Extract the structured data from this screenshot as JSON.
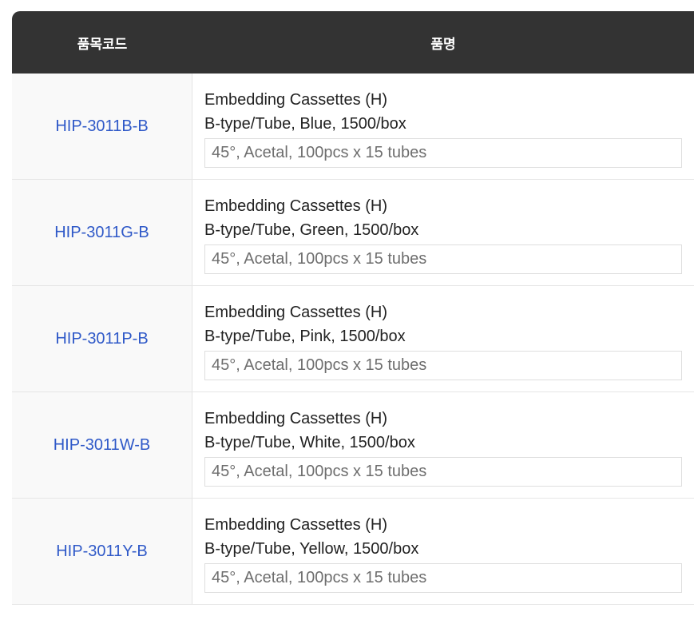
{
  "table": {
    "headers": {
      "code": "품목코드",
      "name": "품명"
    },
    "rows": [
      {
        "code": "HIP-3011B-B",
        "name": "Embedding Cassettes (H)",
        "variant": "B-type/Tube, Blue, 1500/box",
        "spec": "45°, Acetal, 100pcs x 15 tubes"
      },
      {
        "code": "HIP-3011G-B",
        "name": "Embedding Cassettes (H)",
        "variant": "B-type/Tube, Green, 1500/box",
        "spec": "45°, Acetal, 100pcs x 15 tubes"
      },
      {
        "code": "HIP-3011P-B",
        "name": "Embedding Cassettes (H)",
        "variant": "B-type/Tube, Pink, 1500/box",
        "spec": "45°, Acetal, 100pcs x 15 tubes"
      },
      {
        "code": "HIP-3011W-B",
        "name": "Embedding Cassettes (H)",
        "variant": "B-type/Tube, White, 1500/box",
        "spec": "45°, Acetal, 100pcs x 15 tubes"
      },
      {
        "code": "HIP-3011Y-B",
        "name": "Embedding Cassettes (H)",
        "variant": "B-type/Tube, Yellow, 1500/box",
        "spec": "45°, Acetal, 100pcs x 15 tubes"
      }
    ]
  },
  "colors": {
    "header_bg": "#333333",
    "link": "#2f59c8",
    "code_cell_bg": "#f9f9f9"
  }
}
